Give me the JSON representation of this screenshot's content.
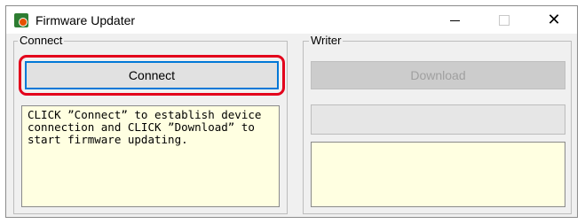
{
  "window": {
    "title": "Firmware Updater",
    "icon": "firmware-updater-app-icon",
    "controls": {
      "minimize": "minimize-icon",
      "maximize": "maximize-icon",
      "close": "✕"
    }
  },
  "connect_group": {
    "label": "Connect",
    "button_label": "Connect",
    "message": "CLICK ”Connect” to establish device\nconnection and CLICK ”Download” to\nstart firmware updating."
  },
  "writer_group": {
    "label": "Writer",
    "button_label": "Download",
    "progress": 0,
    "message": ""
  },
  "colors": {
    "highlight": "#e3001b",
    "focus_border": "#0078d7",
    "message_background": "#ffffe1"
  }
}
